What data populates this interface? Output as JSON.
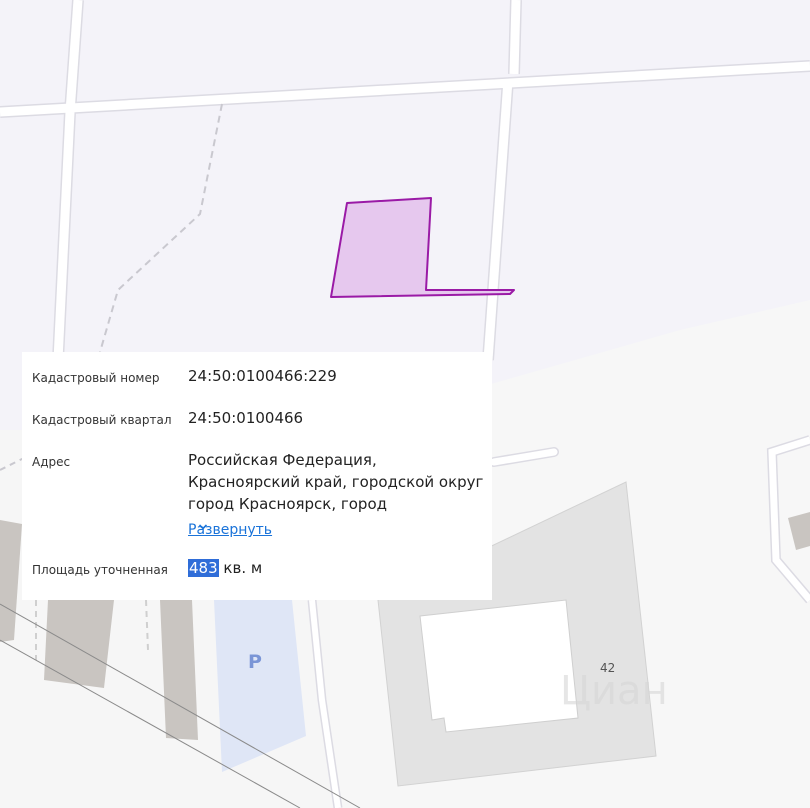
{
  "map": {
    "parking_label": "P",
    "building_number": "42",
    "watermark": "Циан",
    "colors": {
      "background": "#f4f3f9",
      "road": "#ffffff",
      "plot_fill": "#e6c8ee",
      "plot_stroke": "#9a1aa6",
      "building": "#e3e3e3",
      "dark_block": "#c9c5c1",
      "parking": "#dfe6f6"
    }
  },
  "card": {
    "cadastral_number": {
      "label": "Кадастровый номер",
      "value": "24:50:0100466:229"
    },
    "cadastral_quarter": {
      "label": "Кадастровый квартал",
      "value": "24:50:0100466"
    },
    "address": {
      "label": "Адрес",
      "lines": [
        "Российская Федерация,",
        "Красноярский край, городской округ",
        "город Красноярск, город"
      ],
      "expand_label": "Развернуть"
    },
    "area": {
      "label": "Площадь уточненная",
      "value": "483",
      "unit": "кв. м"
    }
  }
}
